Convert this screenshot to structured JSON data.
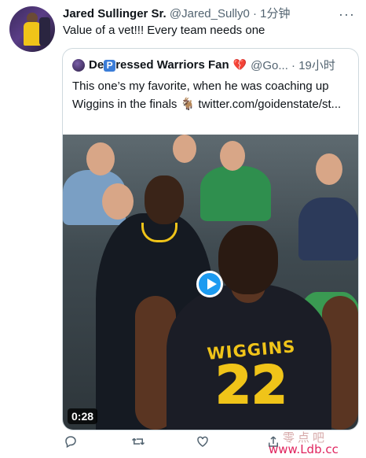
{
  "tweet": {
    "author_name": "Jared Sullinger Sr.",
    "handle_time": "@Jared_Sully0 · 1分钟",
    "text": "Value of a vet!!! Every team needs one"
  },
  "quote": {
    "name_prefix": "De",
    "name_badge": "P",
    "name_suffix": "ressed Warriors Fan",
    "emoji": "💔",
    "handle_time": "@Go... · 19小时",
    "text": "This one’s my favorite, when he was coaching up Wiggins in the finals 🐐 twitter.com/goidenstate/st...",
    "media": {
      "jersey_name": "WIGGINS",
      "jersey_number": "22",
      "duration": "0:28"
    }
  },
  "actions": {
    "reply_icon": "reply-icon",
    "retweet_icon": "retweet-icon",
    "like_icon": "like-icon",
    "share_icon": "share-icon"
  },
  "watermark": {
    "top": "零点吧",
    "bottom": "www.Ldb.cc"
  }
}
